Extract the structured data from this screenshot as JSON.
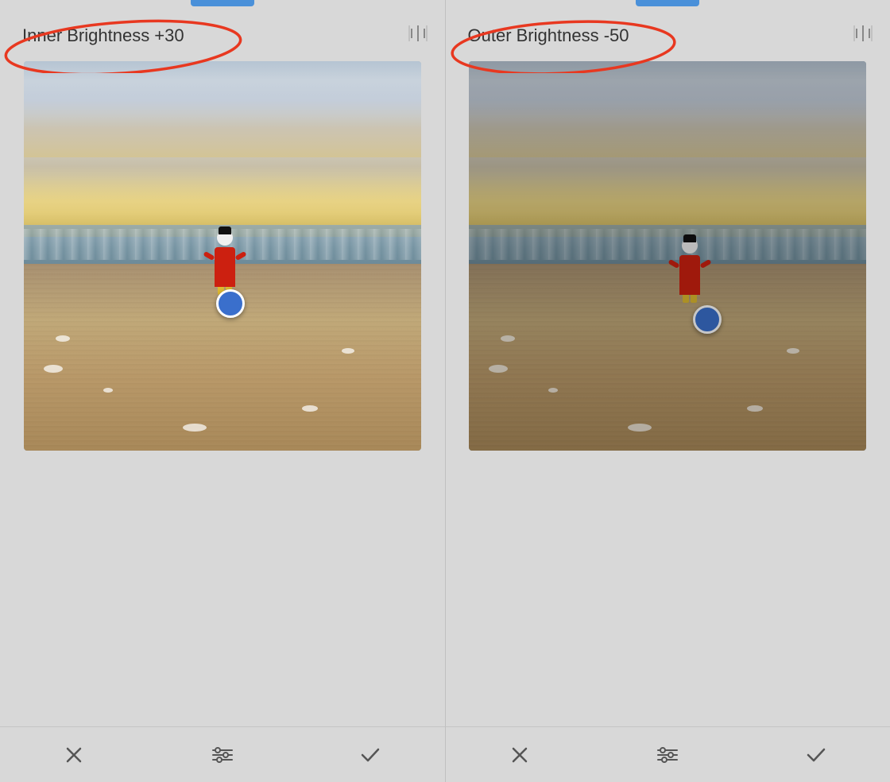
{
  "left_panel": {
    "title": "Inner Brightness +30",
    "split_icon": "⊞",
    "tab_color": "#4a90d9"
  },
  "right_panel": {
    "title": "Outer Brightness -50",
    "split_icon": "⊞",
    "tab_color": "#4a90d9"
  },
  "toolbar_left": {
    "cancel_label": "✕",
    "adjust_label": "≡",
    "confirm_label": "✓"
  },
  "toolbar_right": {
    "cancel_label": "✕",
    "adjust_label": "≡",
    "confirm_label": "✓"
  }
}
